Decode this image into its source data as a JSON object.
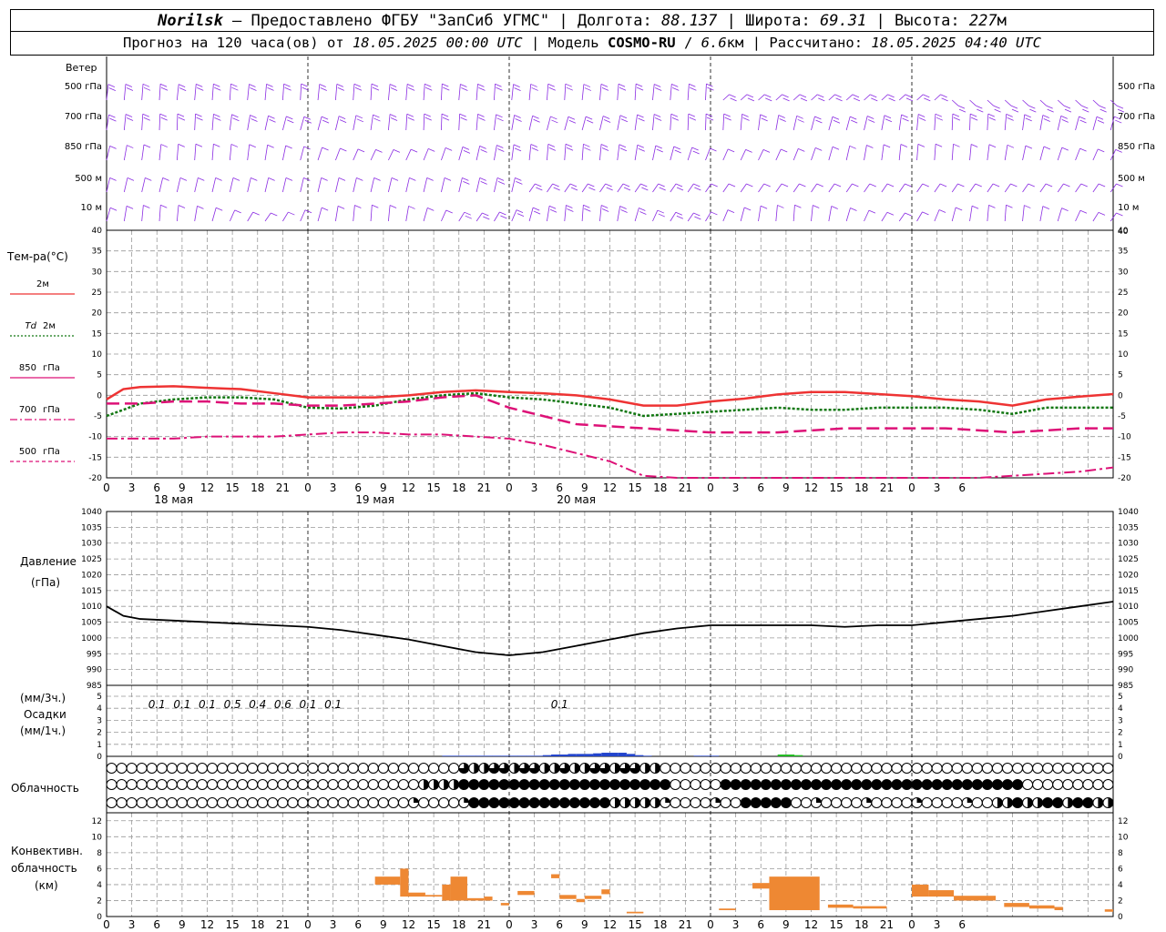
{
  "header": {
    "station": "Norilsk",
    "dash": "–",
    "provider": "Предоставлено ФГБУ \"ЗапСиб УГМС\"",
    "lon_label": "Долгота:",
    "lon": "88.137",
    "lat_label": "Широта:",
    "lat": "69.31",
    "alt_label": "Высота:",
    "alt": "227",
    "alt_unit": "м",
    "sep": "|",
    "forecast_prefix": "Прогноз на 120 часа(ов) от",
    "forecast_time": "18.05.2025 00:00 UTC",
    "model_label": "Модель",
    "model": "COSMO-RU",
    "slash": "/",
    "res": "6.6",
    "res_unit": "км",
    "calc_label": "Рассчитано:",
    "calc_time": "18.05.2025 04:40 UTC"
  },
  "wind_panel": {
    "title": "Ветер",
    "levels": [
      "500 гПа",
      "700 гПа",
      "850 гПа",
      "500 м",
      "10 м"
    ],
    "color": "#8a2be2"
  },
  "temp_panel": {
    "title": "Тем-ра(°С)",
    "legend": [
      {
        "label": "2м",
        "color": "#ee3333",
        "style": "solid"
      },
      {
        "label": "Td",
        "label2": "2м",
        "color": "#117711",
        "style": "dotted"
      },
      {
        "label": "850",
        "label2": "гПа",
        "color": "#dd1177",
        "style": "dash"
      },
      {
        "label": "700",
        "label2": "гПа",
        "color": "#dd1177",
        "style": "dashdot"
      },
      {
        "label": "500",
        "label2": "гПа",
        "color": "#dd1177",
        "style": "shortdash"
      }
    ]
  },
  "pressure_panel": {
    "title1": "Давление",
    "title2": "(гПа)"
  },
  "precip_panel": {
    "title1": "(мм/3ч.)",
    "title2": "Осадки",
    "title3": "(мм/1ч.)",
    "labels": [
      {
        "hour": 6,
        "text": "0.1"
      },
      {
        "hour": 9,
        "text": "0.1"
      },
      {
        "hour": 12,
        "text": "0.1"
      },
      {
        "hour": 15,
        "text": "0.5"
      },
      {
        "hour": 18,
        "text": "0.4"
      },
      {
        "hour": 21,
        "text": "0.6"
      },
      {
        "hour": 24,
        "text": "0.1"
      },
      {
        "hour": 27,
        "text": "0.1"
      },
      {
        "hour": 54,
        "text": "0.1"
      }
    ]
  },
  "cloud_panel": {
    "title": "Облачность"
  },
  "conv_panel": {
    "title1": "Конвективн.",
    "title2": "облачность",
    "title3": "(км)",
    "color": "#ee8833"
  },
  "x_axis": {
    "ticks": [
      "0",
      "3",
      "6",
      "9",
      "12",
      "15",
      "18",
      "21"
    ],
    "end_ticks": [
      "0",
      "3",
      "6"
    ],
    "days": [
      "18 мая",
      "19 мая",
      "20 мая"
    ]
  },
  "chart_data": [
    {
      "type": "line",
      "title": "Тем-ра(°С)",
      "x_unit": "hours since 18.05.2025 00:00 UTC (axis shows hours of day, starting at 18.05.2025 00:00 UTC)",
      "ylim": [
        -20,
        40
      ],
      "yticks": [
        40,
        35,
        30,
        25,
        20,
        15,
        10,
        5,
        0,
        -5,
        -10,
        -15,
        -20
      ],
      "grid": true,
      "series": [
        {
          "name": "2м",
          "x": [
            0,
            2,
            4,
            8,
            12,
            16,
            20,
            24,
            26,
            28,
            32,
            36,
            40,
            44,
            48,
            52,
            56,
            60,
            64,
            68,
            72,
            76,
            80,
            84,
            88,
            92,
            96,
            100,
            104,
            108,
            112,
            116,
            120
          ],
          "values": [
            -1,
            1.5,
            2,
            2.2,
            1.8,
            1.5,
            0.5,
            -0.5,
            -0.5,
            -0.5,
            -0.5,
            0,
            0.8,
            1.2,
            0.8,
            0.5,
            0,
            -1,
            -2.5,
            -2.5,
            -1.5,
            -0.8,
            0.2,
            0.8,
            0.8,
            0.3,
            -0.2,
            -1,
            -1.5,
            -2.5,
            -1,
            -0.3,
            0.3
          ]
        },
        {
          "name": "Td 2м",
          "x": [
            0,
            4,
            8,
            12,
            16,
            20,
            24,
            28,
            32,
            36,
            40,
            44,
            48,
            52,
            56,
            60,
            64,
            68,
            72,
            76,
            80,
            84,
            88,
            92,
            96,
            100,
            104,
            108,
            112,
            116,
            120
          ],
          "values": [
            -5,
            -2,
            -1,
            -0.5,
            -0.5,
            -1,
            -3,
            -3.2,
            -2.5,
            -1,
            0,
            0.5,
            -0.5,
            -1,
            -2,
            -3,
            -5,
            -4.5,
            -4,
            -3.5,
            -3,
            -3.5,
            -3.5,
            -3,
            -3,
            -3,
            -3.5,
            -4.5,
            -3,
            -3,
            -3
          ]
        },
        {
          "name": "850 гПа",
          "x": [
            0,
            4,
            8,
            12,
            16,
            20,
            24,
            28,
            32,
            36,
            40,
            44,
            48,
            52,
            56,
            60,
            64,
            68,
            72,
            76,
            80,
            84,
            88,
            92,
            96,
            100,
            104,
            108,
            112,
            116,
            120
          ],
          "values": [
            -2,
            -2,
            -1.5,
            -1.5,
            -2,
            -2,
            -2.5,
            -2.5,
            -2,
            -1.5,
            -0.5,
            0,
            -3,
            -5,
            -7,
            -7.5,
            -8,
            -8.5,
            -9,
            -9,
            -9,
            -8.5,
            -8,
            -8,
            -8,
            -8,
            -8.5,
            -9,
            -8.5,
            -8,
            -8
          ]
        },
        {
          "name": "700 гПа",
          "x": [
            0,
            4,
            8,
            12,
            16,
            20,
            24,
            28,
            32,
            36,
            40,
            44,
            48,
            52,
            56,
            60,
            64,
            68,
            72,
            76,
            80,
            84,
            88,
            92,
            96,
            100,
            104,
            108,
            112,
            116,
            120
          ],
          "values": [
            -10.5,
            -10.5,
            -10.5,
            -10,
            -10,
            -10,
            -9.5,
            -9,
            -9,
            -9.5,
            -9.5,
            -10,
            -10.5,
            -12,
            -14,
            -16,
            -19.5,
            -21,
            -21,
            -21,
            -21,
            -21,
            -20.5,
            -20,
            -20,
            -20,
            -20,
            -19.5,
            -19,
            -18.5,
            -17.5
          ]
        }
      ]
    },
    {
      "type": "line",
      "title": "Давление (гПа)",
      "x_unit": "hours since 18.05.2025 00:00 UTC (axis shows hours of day, starting at 18.05.2025 00:00 UTC)",
      "ylim": [
        985,
        1040
      ],
      "yticks": [
        1040,
        1035,
        1030,
        1025,
        1020,
        1015,
        1010,
        1005,
        1000,
        995,
        990,
        985
      ],
      "grid": true,
      "series": [
        {
          "name": "",
          "x": [
            0,
            2,
            4,
            8,
            12,
            16,
            20,
            24,
            28,
            32,
            36,
            40,
            44,
            48,
            52,
            56,
            60,
            64,
            68,
            72,
            76,
            80,
            84,
            88,
            92,
            96,
            100,
            104,
            108,
            112,
            116,
            120
          ],
          "values": [
            1010,
            1007,
            1006,
            1005.5,
            1005,
            1004.5,
            1004,
            1003.5,
            1002.5,
            1001,
            999.5,
            997.5,
            995.5,
            994.5,
            995.5,
            997.5,
            999.5,
            1001.5,
            1003,
            1004,
            1004,
            1004,
            1004,
            1003.5,
            1004,
            1004,
            1005,
            1006,
            1007,
            1008.5,
            1010,
            1011.5
          ]
        }
      ]
    },
    {
      "type": "bar",
      "title": "Осадки (мм/1ч.)",
      "x_unit": "hours since 18.05.2025 00:00 UTC (axis shows hours of day, starting at 18.05.2025 00:00 UTC)",
      "ylim": [
        0,
        5
      ],
      "yticks": [
        5,
        4,
        3,
        2,
        1,
        0
      ],
      "series": [
        {
          "name": "",
          "x": [
            40,
            41,
            42,
            43,
            44,
            45,
            46,
            47,
            48,
            49,
            50,
            51,
            52,
            53,
            54,
            55,
            56,
            57,
            58,
            59,
            60,
            61,
            62,
            63,
            64,
            70,
            71,
            72
          ],
          "values": [
            0.05,
            0.05,
            0.05,
            0.05,
            0.05,
            0.05,
            0.05,
            0.05,
            0.05,
            0.05,
            0.05,
            0.05,
            0.1,
            0.15,
            0.15,
            0.2,
            0.2,
            0.2,
            0.25,
            0.3,
            0.3,
            0.3,
            0.2,
            0.1,
            0.05,
            0.05,
            0.05,
            0.05
          ]
        },
        {
          "name": "",
          "x": [
            80,
            81,
            82
          ],
          "values": [
            0.15,
            0.15,
            0.1
          ]
        }
      ]
    },
    {
      "type": "bar",
      "title": "Конвективн. облачность (км)",
      "x_unit": "hours since 18.05.2025 00:00 UTC (axis shows hours of day, starting at 18.05.2025 00:00 UTC)",
      "ylim": [
        0,
        13
      ],
      "yticks": [
        12,
        10,
        8,
        6,
        4,
        2,
        0
      ],
      "series": [
        {
          "name": "",
          "bars": [
            {
              "x0": 32,
              "x1": 35,
              "bottom": 4,
              "top": 5
            },
            {
              "x0": 35,
              "x1": 36,
              "bottom": 2.5,
              "top": 6
            },
            {
              "x0": 36,
              "x1": 38,
              "bottom": 2.5,
              "top": 3
            },
            {
              "x0": 38,
              "x1": 40,
              "bottom": 2.5,
              "top": 2.7
            },
            {
              "x0": 40,
              "x1": 41,
              "bottom": 2,
              "top": 4
            },
            {
              "x0": 41,
              "x1": 43,
              "bottom": 2,
              "top": 5
            },
            {
              "x0": 43,
              "x1": 45,
              "bottom": 2,
              "top": 2.3
            },
            {
              "x0": 45,
              "x1": 46,
              "bottom": 2,
              "top": 2.5
            },
            {
              "x0": 47,
              "x1": 48,
              "bottom": 1.4,
              "top": 1.7
            },
            {
              "x0": 49,
              "x1": 51,
              "bottom": 2.7,
              "top": 3.2
            },
            {
              "x0": 53,
              "x1": 54,
              "bottom": 4.8,
              "top": 5.3
            },
            {
              "x0": 54,
              "x1": 56,
              "bottom": 2.2,
              "top": 2.7
            },
            {
              "x0": 56,
              "x1": 57,
              "bottom": 1.8,
              "top": 2.2
            },
            {
              "x0": 57,
              "x1": 59,
              "bottom": 2.2,
              "top": 2.6
            },
            {
              "x0": 59,
              "x1": 60,
              "bottom": 2.8,
              "top": 3.4
            },
            {
              "x0": 62,
              "x1": 64,
              "bottom": 0.4,
              "top": 0.6
            },
            {
              "x0": 73,
              "x1": 75,
              "bottom": 0.8,
              "top": 1
            },
            {
              "x0": 77,
              "x1": 79,
              "bottom": 3.5,
              "top": 4.2
            },
            {
              "x0": 79,
              "x1": 85,
              "bottom": 0.8,
              "top": 5
            },
            {
              "x0": 86,
              "x1": 89,
              "bottom": 1.1,
              "top": 1.5
            },
            {
              "x0": 89,
              "x1": 93,
              "bottom": 1,
              "top": 1.3
            },
            {
              "x0": 96,
              "x1": 98,
              "bottom": 2.5,
              "top": 4
            },
            {
              "x0": 98,
              "x1": 101,
              "bottom": 2.5,
              "top": 3.3
            },
            {
              "x0": 101,
              "x1": 106,
              "bottom": 2,
              "top": 2.6
            },
            {
              "x0": 107,
              "x1": 110,
              "bottom": 1.2,
              "top": 1.7
            },
            {
              "x0": 110,
              "x1": 113,
              "bottom": 1,
              "top": 1.4
            },
            {
              "x0": 113,
              "x1": 114,
              "bottom": 0.8,
              "top": 1.2
            },
            {
              "x0": 119,
              "x1": 120,
              "bottom": 0.6,
              "top": 0.9
            }
          ]
        }
      ]
    }
  ]
}
